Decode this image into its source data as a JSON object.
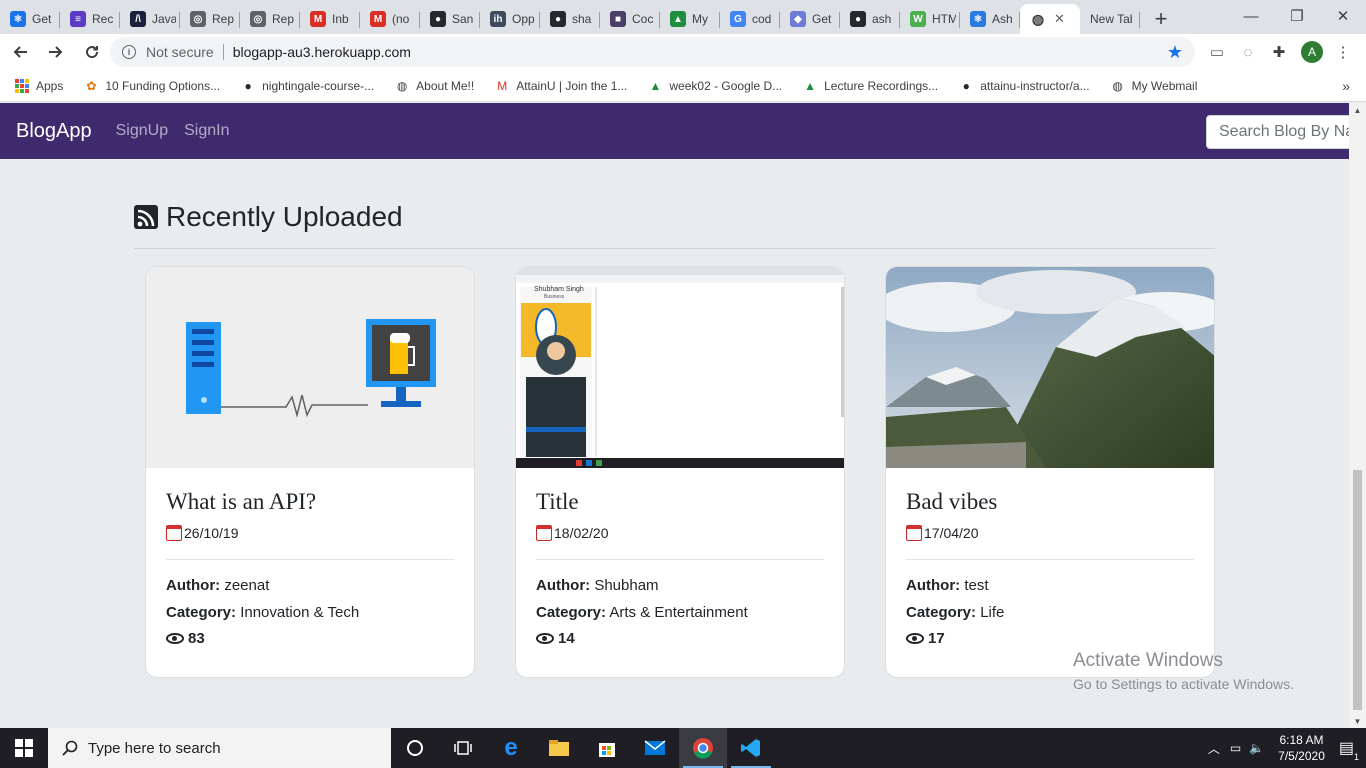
{
  "browser": {
    "tabs": [
      {
        "label": "Get",
        "color": "#1a73e8",
        "glyph": "⚛"
      },
      {
        "label": "Rec",
        "color": "#5c3bc4",
        "glyph": "≡"
      },
      {
        "label": "Java",
        "color": "#1b1f3b",
        "glyph": "/\\"
      },
      {
        "label": "Rep",
        "color": "#5f6368",
        "glyph": "◎"
      },
      {
        "label": "Rep",
        "color": "#5f6368",
        "glyph": "◎"
      },
      {
        "label": "Inb",
        "color": "#d93025",
        "glyph": "M"
      },
      {
        "label": "(no",
        "color": "#d93025",
        "glyph": "M"
      },
      {
        "label": "San",
        "color": "#24292e",
        "glyph": "●"
      },
      {
        "label": "Opp",
        "color": "#3d4b5c",
        "glyph": "ih"
      },
      {
        "label": "sha",
        "color": "#24292e",
        "glyph": "●"
      },
      {
        "label": "Coc",
        "color": "#4a3f66",
        "glyph": "■"
      },
      {
        "label": "My",
        "color": "#1e8e3e",
        "glyph": "▲"
      },
      {
        "label": "cod",
        "color": "#4285f4",
        "glyph": "G"
      },
      {
        "label": "Get",
        "color": "#6d7ad6",
        "glyph": "◆"
      },
      {
        "label": "ash",
        "color": "#24292e",
        "glyph": "●"
      },
      {
        "label": "HTM",
        "color": "#4caf50",
        "glyph": "W"
      },
      {
        "label": "Ash",
        "color": "#2a7ae2",
        "glyph": "⚛"
      }
    ],
    "active_tab_close": "✕",
    "new_tab_label": "New Tab",
    "new_tab_button": "+",
    "window_controls": {
      "minimize": "—",
      "restore": "❐",
      "close": "✕"
    },
    "address": {
      "security_label": "Not secure",
      "url": "blogapp-au3.herokuapp.com"
    },
    "profile_initial": "A",
    "bookmarks": [
      {
        "label": "Apps",
        "icon": "apps-grid-icon"
      },
      {
        "label": "10 Funding Options...",
        "icon": "funding-icon"
      },
      {
        "label": "nightingale-course-...",
        "icon": "github-icon"
      },
      {
        "label": "About Me!!",
        "icon": "globe-icon"
      },
      {
        "label": "AttainU | Join the 1...",
        "icon": "gmail-icon"
      },
      {
        "label": "week02 - Google D...",
        "icon": "drive-icon"
      },
      {
        "label": "Lecture Recordings...",
        "icon": "drive-icon"
      },
      {
        "label": "attainu-instructor/a...",
        "icon": "github-icon"
      },
      {
        "label": "My Webmail",
        "icon": "globe-icon"
      }
    ],
    "bookmarks_more": "»"
  },
  "app": {
    "brand": "BlogApp",
    "nav": {
      "signup": "SignUp",
      "signin": "SignIn"
    },
    "search_placeholder": "Search Blog By Name",
    "section_title": "Recently Uploaded",
    "posts": [
      {
        "title": "What is an API?",
        "date": "26/10/19",
        "author": "zeenat",
        "category": "Innovation & Tech",
        "views": "83"
      },
      {
        "title": "Title",
        "date": "18/02/20",
        "author": "Shubham",
        "category": "Arts & Entertainment",
        "views": "14"
      },
      {
        "title": "Bad vibes",
        "date": "17/04/20",
        "author": "test",
        "category": "Life",
        "views": "17"
      }
    ],
    "labels": {
      "author": "Author:",
      "category": "Category:"
    },
    "screenshot_text": {
      "name": "Shubham Singh",
      "role": "Business"
    }
  },
  "watermark": {
    "line1": "Activate Windows",
    "line2": "Go to Settings to activate Windows."
  },
  "taskbar": {
    "search_placeholder": "Type here to search",
    "time": "6:18 AM",
    "date": "7/5/2020",
    "notification_count": "1"
  }
}
